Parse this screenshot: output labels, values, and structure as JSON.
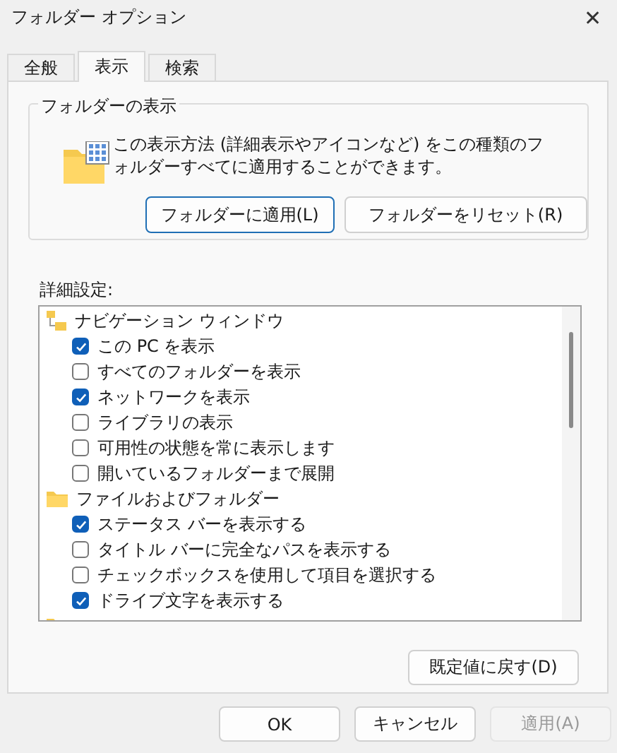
{
  "window": {
    "title": "フォルダー オプション",
    "close": "✕"
  },
  "tabs": [
    {
      "label": "全般",
      "selected": false
    },
    {
      "label": "表示",
      "selected": true
    },
    {
      "label": "検索",
      "selected": false
    }
  ],
  "folder_views": {
    "title": "フォルダーの表示",
    "description": "この表示方法 (詳細表示やアイコンなど) をこの種類のフォルダーすべてに適用することができます。",
    "buttons": [
      {
        "label": "フォルダーに適用(L)",
        "focused": true
      },
      {
        "label": "フォルダーをリセット(R)",
        "focused": false
      }
    ]
  },
  "advanced": {
    "label": "詳細設定:",
    "items": [
      {
        "kind": "navigation",
        "label": "ナビゲーション ウィンドウ",
        "children": [
          {
            "label": "この PC を表示",
            "checked": true
          },
          {
            "label": "すべてのフォルダーを表示",
            "checked": false
          },
          {
            "label": "ネットワークを表示",
            "checked": true
          },
          {
            "label": "ライブラリの表示",
            "checked": false
          },
          {
            "label": "可用性の状態を常に表示します",
            "checked": false
          },
          {
            "label": "開いているフォルダーまで展開",
            "checked": false
          }
        ]
      },
      {
        "kind": "folder",
        "label": "ファイルおよびフォルダー",
        "children": [
          {
            "label": "ステータス バーを表示する",
            "checked": true
          },
          {
            "label": "タイトル バーに完全なパスを表示する",
            "checked": false
          },
          {
            "label": "チェックボックスを使用して項目を選択する",
            "checked": false
          },
          {
            "label": "ドライブ文字を表示する",
            "checked": true
          }
        ]
      },
      {
        "kind": "folder_partial"
      }
    ],
    "restore_button": "既定値に戻す(D)"
  },
  "buttons": [
    {
      "label": "OK",
      "disabled": false
    },
    {
      "label": "キャンセル",
      "disabled": false
    },
    {
      "label": "適用(A)",
      "disabled": true
    }
  ]
}
